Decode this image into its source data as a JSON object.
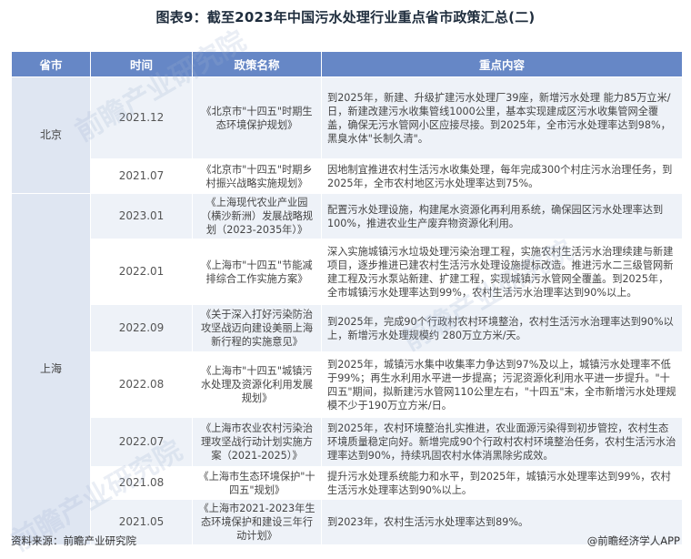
{
  "title": "图表9：截至2023年中国污水处理行业重点省市政策汇总(二)",
  "headers": [
    "省市",
    "时间",
    "政策名称",
    "重点内容"
  ],
  "provinces": [
    {
      "name": "北京",
      "rows": [
        {
          "date": "2021.12",
          "policy": "《北京市\"十四五\"时期生态环境保护规划》",
          "content": "到2025年，新建、升级扩建污水处理厂39座，新增污水处理 能力85万立米/日，新建改建污水收集管线1000公里，基本实现建成区污水收集管网全覆盖，确保无污水管网小区应接尽接。到2025年，全市污水处理率达到98%，黑臭水体\"长制久清\"。"
        },
        {
          "date": "2021.07",
          "policy": "《北京市\"十四五\"时期乡村振兴战略实施规划》",
          "content": "因地制宜推进农村生活污水收集处理，每年完成300个村庄污水治理任务，到2025年，全市农村地区污水处理率达到75%。"
        }
      ]
    },
    {
      "name": "上海",
      "rows": [
        {
          "date": "2023.01",
          "policy": "《上海现代农业产业园（横沙新洲）发展战略规划（2023-2035年）》",
          "content": "配置污水处理设施，构建尾水资源化再利用系统，确保园区污水处理率达到100%，推进农业生产废弃物资源化利用。"
        },
        {
          "date": "2022.01",
          "policy": "《上海市\"十四五\"节能减排综合工作实施方案》",
          "content": "深入实施城镇污水垃圾处理污染治理工程，实施农村生活污水治理续建与新建项目，逐步推进已建农村生活污水处理设施提标改造。推进污水二三级管网新建工程及污水泵站新建、扩建工程，实现城镇污水管网全覆盖。到2025年，全市城镇污水处理率达到99%，农村生活污水治理率达到90%以上。"
        },
        {
          "date": "2022.09",
          "policy": "《关于深入打好污染防治攻坚战迈向建设美丽上海新行程的实施意见》",
          "content": "到2025年，完成90个行政村农村环境整治，农村生活污水治理率达到90%以上，新增污水处理规模约 280万立方米/天。"
        },
        {
          "date": "2022.08",
          "policy": "《上海市\"十四五\"城镇污水处理及资源化利用发展规划》",
          "content": "到2025年，城镇污水集中收集率力争达到97%及以上，城镇污水处理率不低于99%；再生水利用水平进一步提高；污泥资源化利用水平进一步提升。\"十四五\"期间，拟新建污水管网110公里左右，\"十四五\"末，全市新增污水处理规模不少于190万立方米/日。"
        },
        {
          "date": "2022.07",
          "policy": "《上海市农业农村污染治理攻坚战行动计划实施方案（2021-2025）》",
          "content": "到2025年，农村环境整治扎实推进，农业面源污染得到初步管控，农村生态环境质量稳定向好。新增完成90个行政村农村环境整治任务，农村生活污水治理率达到90%，持续巩固农村水体消黑除劣成效。"
        },
        {
          "date": "2021.08",
          "policy": "《上海市生态环境保护\"十四五\"规划》",
          "content": "提升污水处理系统能力和水平，到2025年，城镇污水处理率达到99%，农村生活污水处理率达到90%以上。"
        },
        {
          "date": "2021.05",
          "policy": "《上海市2021-2023年生态环境保护和建设三年行动计划》",
          "content": "到2023年，农村生活污水处理率达到89%。"
        }
      ]
    }
  ],
  "footer": {
    "source": "资料来源：前瞻产业研究院",
    "brand": "@前瞻经济学人APP"
  },
  "watermark": "前瞻产业研究院"
}
